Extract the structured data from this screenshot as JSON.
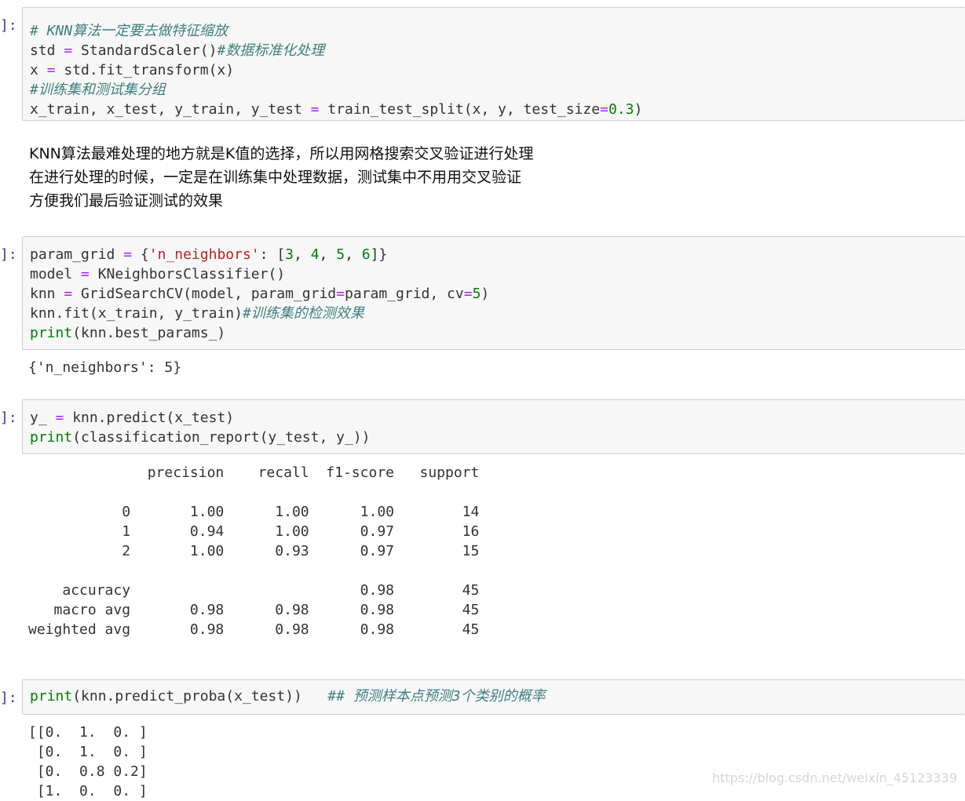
{
  "prompts": [
    "]:",
    "]:",
    "]:",
    "]:"
  ],
  "cell1": {
    "lines": [
      {
        "segments": [
          {
            "t": "# KNN算法一定要去做特征缩放",
            "c": "cm"
          }
        ]
      },
      {
        "segments": [
          {
            "t": "std ",
            "c": ""
          },
          {
            "t": "=",
            "c": "op"
          },
          {
            "t": " StandardScaler()",
            "c": ""
          },
          {
            "t": "#数据标准化处理",
            "c": "cm"
          }
        ]
      },
      {
        "segments": [
          {
            "t": "x ",
            "c": ""
          },
          {
            "t": "=",
            "c": "op"
          },
          {
            "t": " std.fit_transform(x)",
            "c": ""
          }
        ]
      },
      {
        "segments": [
          {
            "t": "#训练集和测试集分组",
            "c": "cm"
          }
        ]
      },
      {
        "segments": [
          {
            "t": "x_train, x_test, y_train, y_test ",
            "c": ""
          },
          {
            "t": "=",
            "c": "op"
          },
          {
            "t": " train_test_split(x, y, test_size",
            "c": ""
          },
          {
            "t": "=",
            "c": "op"
          },
          {
            "t": "0.3",
            "c": "num"
          },
          {
            "t": ")",
            "c": ""
          }
        ]
      }
    ]
  },
  "markdown": {
    "lines": [
      "KNN算法最难处理的地方就是K值的选择，所以用网格搜索交叉验证进行处理",
      "在进行处理的时候，一定是在训练集中处理数据，测试集中不用用交叉验证",
      "方便我们最后验证测试的效果"
    ]
  },
  "cell2": {
    "lines": [
      {
        "segments": [
          {
            "t": "param_grid ",
            "c": ""
          },
          {
            "t": "=",
            "c": "op"
          },
          {
            "t": " {",
            "c": ""
          },
          {
            "t": "'n_neighbors'",
            "c": "str"
          },
          {
            "t": ": [",
            "c": ""
          },
          {
            "t": "3",
            "c": "num"
          },
          {
            "t": ", ",
            "c": ""
          },
          {
            "t": "4",
            "c": "num"
          },
          {
            "t": ", ",
            "c": ""
          },
          {
            "t": "5",
            "c": "num"
          },
          {
            "t": ", ",
            "c": ""
          },
          {
            "t": "6",
            "c": "num"
          },
          {
            "t": "]}",
            "c": ""
          }
        ]
      },
      {
        "segments": [
          {
            "t": "model ",
            "c": ""
          },
          {
            "t": "=",
            "c": "op"
          },
          {
            "t": " KNeighborsClassifier()",
            "c": ""
          }
        ]
      },
      {
        "segments": [
          {
            "t": "knn ",
            "c": ""
          },
          {
            "t": "=",
            "c": "op"
          },
          {
            "t": " GridSearchCV(model, param_grid",
            "c": ""
          },
          {
            "t": "=",
            "c": "op"
          },
          {
            "t": "param_grid, cv",
            "c": ""
          },
          {
            "t": "=",
            "c": "op"
          },
          {
            "t": "5",
            "c": "num"
          },
          {
            "t": ")",
            "c": ""
          }
        ]
      },
      {
        "segments": [
          {
            "t": "knn.fit(x_train, y_train)",
            "c": ""
          },
          {
            "t": "#训练集的检测效果",
            "c": "cm"
          }
        ]
      },
      {
        "segments": [
          {
            "t": "print",
            "c": "kw"
          },
          {
            "t": "(knn.best_params_)",
            "c": ""
          }
        ]
      }
    ],
    "output": [
      "{'n_neighbors': 5}"
    ]
  },
  "cell3": {
    "lines": [
      {
        "segments": [
          {
            "t": "y_ ",
            "c": ""
          },
          {
            "t": "=",
            "c": "op"
          },
          {
            "t": " knn.predict(x_test)",
            "c": ""
          }
        ]
      },
      {
        "segments": [
          {
            "t": "print",
            "c": "kw"
          },
          {
            "t": "(classification_report(y_test, y_))",
            "c": ""
          }
        ]
      }
    ],
    "output": [
      "              precision    recall  f1-score   support",
      "",
      "           0       1.00      1.00      1.00        14",
      "           1       0.94      1.00      0.97        16",
      "           2       1.00      0.93      0.97        15",
      "",
      "    accuracy                           0.98        45",
      "   macro avg       0.98      0.98      0.98        45",
      "weighted avg       0.98      0.98      0.98        45"
    ]
  },
  "cell4": {
    "lines": [
      {
        "segments": [
          {
            "t": "print",
            "c": "kw"
          },
          {
            "t": "(knn.predict_proba(x_test))   ",
            "c": ""
          },
          {
            "t": "## 预测样本点预测3个类别的概率",
            "c": "cm"
          }
        ]
      }
    ],
    "output": [
      "[[0.  1.  0. ]",
      " [0.  1.  0. ]",
      " [0.  0.8 0.2]",
      " [1.  0.  0. ]"
    ]
  },
  "watermark": "https://blog.csdn.net/weixin_45123339"
}
